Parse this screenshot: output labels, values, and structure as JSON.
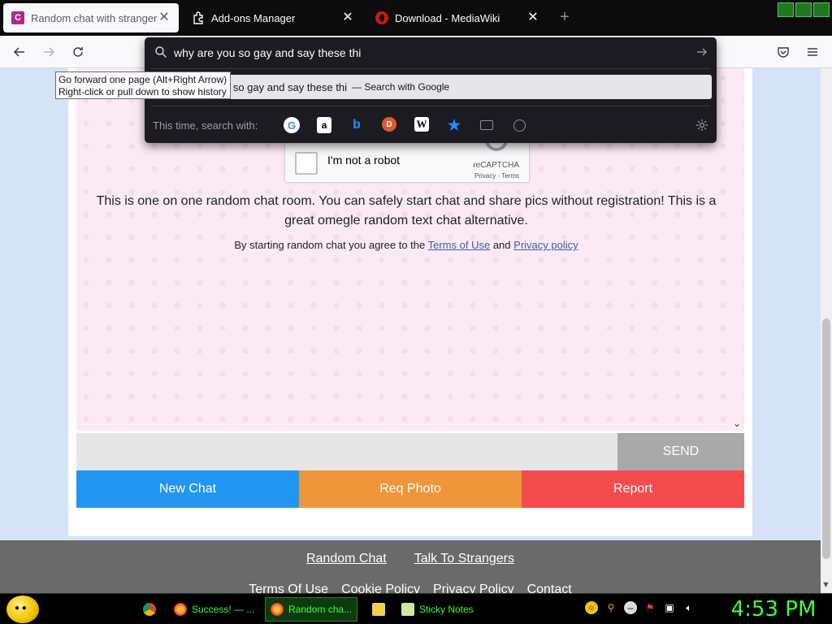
{
  "tabs": [
    {
      "label": "Random chat with strangers",
      "favicon": "C",
      "favicon_color": "#b02a8a",
      "active": true
    },
    {
      "label": "Add-ons Manager",
      "favicon": "puzzle-icon",
      "active": false
    },
    {
      "label": "Download - MediaWiki",
      "favicon": "opera-icon",
      "favicon_color": "#d01818",
      "active": false
    }
  ],
  "tooltip": {
    "line1": "Go forward one page (Alt+Right Arrow)",
    "line2": "Right-click or pull down to show history"
  },
  "urlbar": {
    "query": "why are you so gay and say these thi",
    "suggestion_text": "u so gay and say these thi",
    "suggestion_engine": "— Search with Google",
    "one_time_label": "This time, search with:",
    "engines": [
      "google-icon",
      "amazon-icon",
      "bing-icon",
      "duckduckgo-icon",
      "wikipedia-icon",
      "bookmarks-icon",
      "tabs-icon",
      "history-icon"
    ]
  },
  "captcha": {
    "label": "I'm not a robot",
    "brand": "reCAPTCHA",
    "terms": "Privacy - Terms"
  },
  "page": {
    "intro": "This is one on one random chat room. You can safely start chat and share pics without registration! This is a great omegle random text chat alternative.",
    "agree_prefix": "By starting random chat you agree to the",
    "terms_link": "Terms of Use",
    "agree_and": "and",
    "privacy_link": "Privacy policy"
  },
  "composer": {
    "send": "SEND",
    "placeholder": ""
  },
  "actions": [
    {
      "label": "New Chat",
      "color": "#2296f3"
    },
    {
      "label": "Req Photo",
      "color": "#f0963a"
    },
    {
      "label": "Report",
      "color": "#f44c4c"
    }
  ],
  "footer": {
    "links_primary": [
      "Random Chat",
      "Talk To Strangers"
    ],
    "links_secondary": [
      "Terms Of Use",
      "Cookie Policy",
      "Privacy Policy",
      "Contact"
    ]
  },
  "taskbar": {
    "items": [
      {
        "label": "Success! — ...",
        "active": false
      },
      {
        "label": "Random cha...",
        "active": true
      },
      {
        "label": "Sticky Notes",
        "active": false
      }
    ],
    "clock": "4:53 PM"
  }
}
